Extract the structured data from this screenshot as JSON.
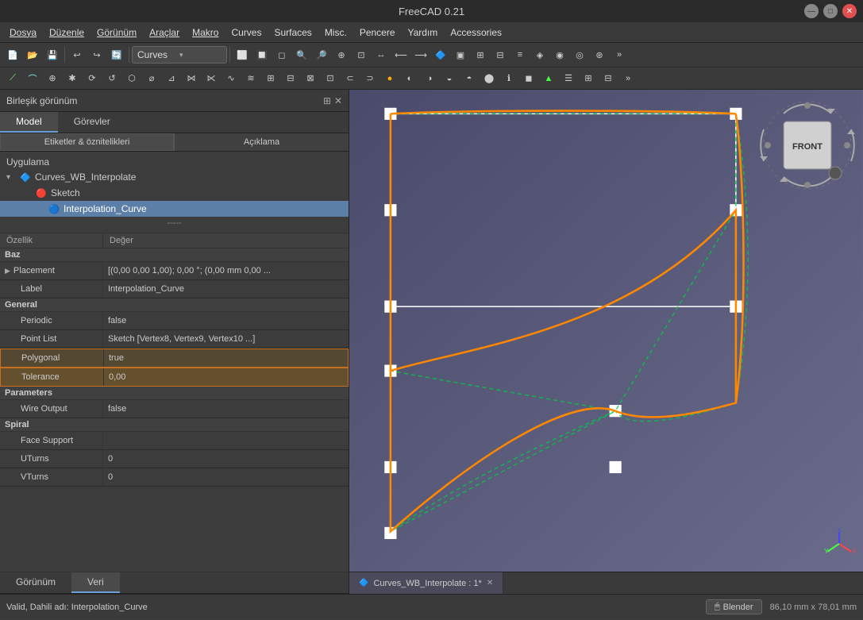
{
  "titleBar": {
    "title": "FreeCAD 0.21",
    "minimize": "—",
    "maximize": "□",
    "close": "✕"
  },
  "menuBar": {
    "items": [
      {
        "label": "Dosya",
        "underline": true
      },
      {
        "label": "Düzenle",
        "underline": true
      },
      {
        "label": "Görünüm",
        "underline": true
      },
      {
        "label": "Araçlar",
        "underline": true
      },
      {
        "label": "Makro",
        "underline": true
      },
      {
        "label": "Curves",
        "underline": false
      },
      {
        "label": "Surfaces",
        "underline": false
      },
      {
        "label": "Misc.",
        "underline": false
      },
      {
        "label": "Pencere",
        "underline": false
      },
      {
        "label": "Yardım",
        "underline": false
      },
      {
        "label": "Accessories",
        "underline": false
      }
    ]
  },
  "toolbar": {
    "workbench_label": "Curves",
    "workbench_arrow": "▾"
  },
  "leftPanel": {
    "header_title": "Birleşik görünüm",
    "expand_icon": "⊞",
    "close_icon": "✕",
    "tabs": [
      "Model",
      "Görevler"
    ],
    "active_tab": "Model",
    "sub_tabs": [
      "Etiketler & öznitelikleri",
      "Açıklama"
    ],
    "tree": {
      "label": "Uygulama",
      "items": [
        {
          "id": "curves_wb",
          "label": "Curves_WB_Interpolate",
          "icon": "🔷",
          "expand": "▾",
          "indent": 0
        },
        {
          "id": "sketch",
          "label": "Sketch",
          "icon": "🔴",
          "expand": "",
          "indent": 1
        },
        {
          "id": "interp",
          "label": "Interpolation_Curve",
          "icon": "🔵",
          "expand": "",
          "indent": 2,
          "selected": true
        }
      ],
      "divider": "-----"
    },
    "propsHeader": {
      "col1": "Özellik",
      "col2": "Değer"
    },
    "sections": [
      {
        "name": "Baz",
        "rows": [
          {
            "name": "Placement",
            "value": "[(0,00 0,00 1,00); 0,00 °; (0,00 mm  0,00 ...",
            "has_expand": true,
            "indent": 1
          },
          {
            "name": "Label",
            "value": "Interpolation_Curve",
            "indent": 2
          }
        ]
      },
      {
        "name": "General",
        "rows": [
          {
            "name": "Periodic",
            "value": "false",
            "indent": 2
          },
          {
            "name": "Point List",
            "value": "Sketch [Vertex8, Vertex9, Vertex10 ...]",
            "indent": 2
          },
          {
            "name": "Polygonal",
            "value": "true",
            "indent": 2,
            "highlight": true
          },
          {
            "name": "Tolerance",
            "value": "0,00",
            "indent": 2,
            "highlight_active": true
          }
        ]
      },
      {
        "name": "Parameters",
        "rows": [
          {
            "name": "Wire Output",
            "value": "false",
            "indent": 2
          }
        ]
      },
      {
        "name": "Spiral",
        "rows": [
          {
            "name": "Face Support",
            "value": "",
            "indent": 2
          },
          {
            "name": "UTurns",
            "value": "0",
            "indent": 2
          },
          {
            "name": "VTurns",
            "value": "0",
            "indent": 2
          }
        ]
      }
    ],
    "bottomTabs": [
      "Görünüm",
      "Veri"
    ],
    "active_bottom_tab": "Veri"
  },
  "statusBar": {
    "text": "Valid, Dahili adı: Interpolation_Curve",
    "blender_label": "Blender",
    "blender_icon": "🖱",
    "coords": "86,10 mm x 78,01 mm"
  },
  "viewport": {
    "tab_icon": "🔷",
    "tab_label": "Curves_WB_Interpolate : 1*",
    "tab_close": "✕"
  },
  "compass": {
    "front_label": "FRONT"
  }
}
